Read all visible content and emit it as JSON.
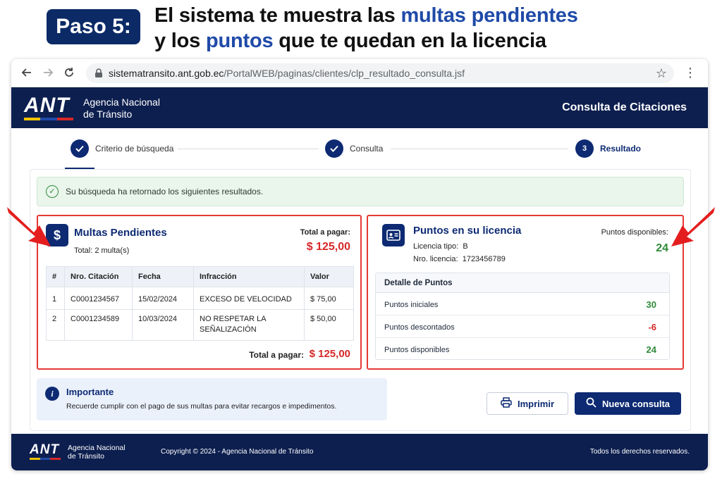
{
  "headline": {
    "step": "Paso 5:",
    "line1_a": "El sistema te muestra las ",
    "line1_b": "multas pendientes",
    "line2_a": "y los ",
    "line2_b": "puntos",
    "line2_c": " que te quedan en la licencia"
  },
  "browser": {
    "url_domain": "sistematransito.ant.gob.ec",
    "url_path": "/PortalWEB/paginas/clientes/clp_resultado_consulta.jsf"
  },
  "header": {
    "logo": "ANT",
    "agency_line1": "Agencia Nacional",
    "agency_line2": "de Tránsito",
    "title": "Consulta de Citaciones"
  },
  "stepper": {
    "steps": [
      {
        "label": "Criterio de búsqueda",
        "state": "done"
      },
      {
        "label": "Consulta",
        "state": "done"
      },
      {
        "label": "Resultado",
        "number": "3",
        "state": "active"
      }
    ]
  },
  "alert": {
    "message": "Su búsqueda ha retornado los siguientes resultados."
  },
  "multas": {
    "icon": "$",
    "title": "Multas Pendientes",
    "total_count": "Total: 2 multa(s)",
    "total_label": "Total a pagar:",
    "total_amount": "$ 125,00",
    "columns": [
      "#",
      "Nro. Citación",
      "Fecha",
      "Infracción",
      "Valor"
    ],
    "rows": [
      {
        "n": "1",
        "citacion": "C0001234567",
        "fecha": "15/02/2024",
        "infraccion": "EXCESO DE VELOCIDAD",
        "valor": "$ 75,00"
      },
      {
        "n": "2",
        "citacion": "C0001234589",
        "fecha": "10/03/2024",
        "infraccion_1": "NO RESPETAR LA",
        "infraccion_2": "SEÑALIZACIÓN",
        "valor": "$ 50,00"
      }
    ],
    "footer_total_label": "Total a pagar:",
    "footer_total_amount": "$ 125,00"
  },
  "puntos": {
    "title": "Puntos en su licencia",
    "tipo_label": "Licencia tipo:",
    "tipo_value": "B",
    "nro_label": "Nro. licencia:",
    "nro_value": "1723456789",
    "disponibles_label": "Puntos disponibles:",
    "disponibles_value": "24",
    "detail_title": "Detalle de Puntos",
    "detail": [
      {
        "label": "Puntos iniciales",
        "value": "30"
      },
      {
        "label": "Puntos descontados",
        "value": "-6"
      },
      {
        "label": "Puntos disponibles",
        "value": "24"
      }
    ]
  },
  "important": {
    "title": "Importante",
    "text": "Recuerde cumplir con el pago de sus multas para evitar recargos e impedimentos."
  },
  "buttons": {
    "print": "Imprimir",
    "new": "Nueva consulta"
  },
  "footer": {
    "logo": "ANT",
    "agency_line1": "Agencia Nacional",
    "agency_line2": "de Tránsito",
    "copyright": "Copyright © 2024 - Agencia Nacional de Tránsito",
    "rights": "Todos los derechos reservados."
  },
  "colors": {
    "navy": "#0d1f4f",
    "brand": "#0d2a72",
    "highlight": "#1f4aa8",
    "red": "#e53935",
    "green": "#2e8b3a"
  }
}
